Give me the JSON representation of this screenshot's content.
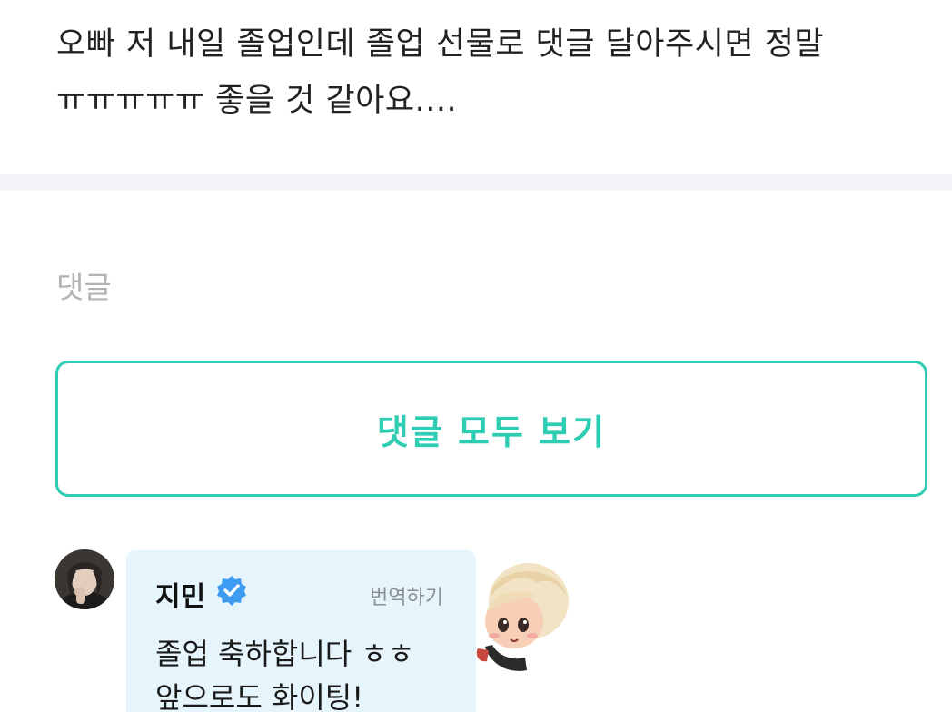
{
  "post": {
    "line1": "오빠 저 내일 졸업인데 졸업 선물로 댓글 달아주시면 정말",
    "line2": "ㅠㅠㅠㅠㅠ 좋을 것 같아요...."
  },
  "comments_section": {
    "label": "댓글",
    "view_all_label": "댓글 모두 보기",
    "accent_color": "#2ecdb3"
  },
  "comment": {
    "author": "지민",
    "verified_icon": "verified-badge-icon",
    "translate_label": "번역하기",
    "text_line1": "졸업 축하합니다 ㅎㅎ",
    "text_line2": "앞으로도 화이팅!",
    "bubble_color": "#e6f5fb",
    "sticker": "character-sticker"
  }
}
